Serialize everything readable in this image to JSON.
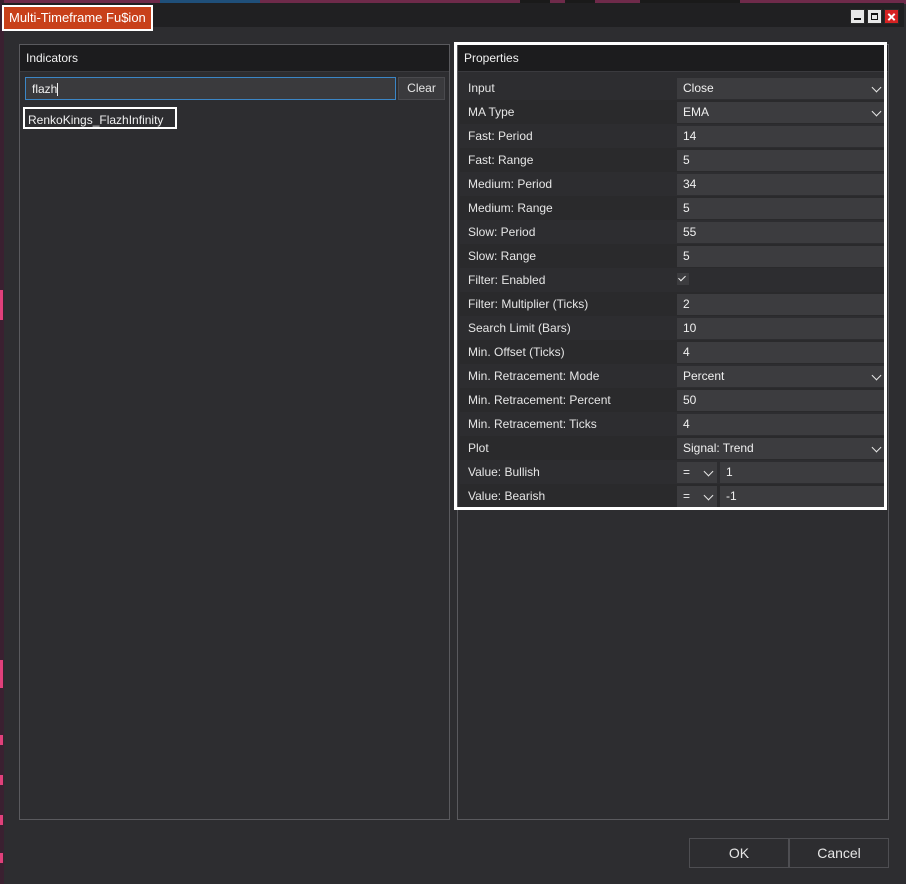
{
  "window": {
    "title": "Multi-Timeframe Fu$ion",
    "buttons": [
      "minimize-icon",
      "maximize-icon",
      "close-icon"
    ]
  },
  "indicators": {
    "header": "Indicators",
    "search": {
      "value": "flazh",
      "placeholder": ""
    },
    "clear_label": "Clear",
    "results": [
      "RenkoKings_FlazhInfinity"
    ]
  },
  "properties": {
    "header": "Properties",
    "rows": [
      {
        "label": "Input",
        "value": "Close",
        "kind": "select"
      },
      {
        "label": "MA Type",
        "value": "EMA",
        "kind": "select"
      },
      {
        "label": "Fast: Period",
        "value": "14",
        "kind": "text"
      },
      {
        "label": "Fast: Range",
        "value": "5",
        "kind": "text"
      },
      {
        "label": "Medium: Period",
        "value": "34",
        "kind": "text"
      },
      {
        "label": "Medium: Range",
        "value": "5",
        "kind": "text"
      },
      {
        "label": "Slow: Period",
        "value": "55",
        "kind": "text"
      },
      {
        "label": "Slow: Range",
        "value": "5",
        "kind": "text"
      },
      {
        "label": "Filter: Enabled",
        "value": true,
        "kind": "checkbox"
      },
      {
        "label": "Filter: Multiplier (Ticks)",
        "value": "2",
        "kind": "text"
      },
      {
        "label": "Search Limit (Bars)",
        "value": "10",
        "kind": "text"
      },
      {
        "label": "Min. Offset (Ticks)",
        "value": "4",
        "kind": "text"
      },
      {
        "label": "Min. Retracement: Mode",
        "value": "Percent",
        "kind": "select"
      },
      {
        "label": "Min. Retracement: Percent",
        "value": "50",
        "kind": "text"
      },
      {
        "label": "Min. Retracement: Ticks",
        "value": "4",
        "kind": "text"
      },
      {
        "label": "Plot",
        "value": "Signal: Trend",
        "kind": "select"
      },
      {
        "label": "Value: Bullish",
        "operator": "=",
        "value": "1",
        "kind": "compare"
      },
      {
        "label": "Value: Bearish",
        "operator": "=",
        "value": "-1",
        "kind": "compare"
      }
    ]
  },
  "footer": {
    "ok_label": "OK",
    "cancel_label": "Cancel"
  },
  "colors": {
    "title_accent": "#c8401a",
    "search_focus": "#3b86c6",
    "background": "#2d2d30"
  }
}
